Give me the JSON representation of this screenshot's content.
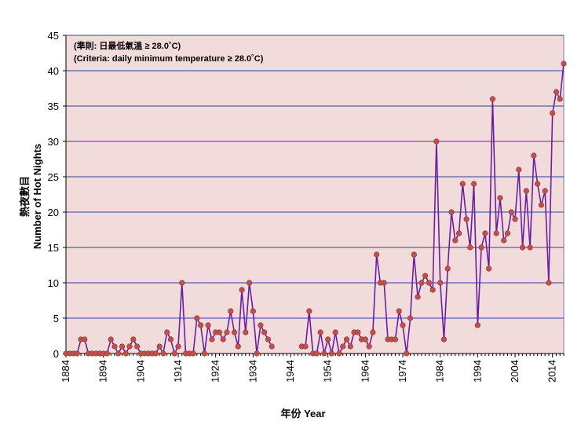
{
  "chart_data": {
    "type": "line",
    "annotation_lines": [
      "(準則: 日最低氣溫 ≥ 28.0˚C)",
      "(Criteria: daily minimum temperature ≥ 28.0˚C)"
    ],
    "ylabel_zh": "熱夜數目",
    "ylabel_en": "Number of Hot Nights",
    "xlabel": "年份 Year",
    "xlim": [
      1884,
      2017
    ],
    "ylim": [
      0,
      45
    ],
    "x_ticks": [
      1884,
      1894,
      1904,
      1914,
      1924,
      1934,
      1944,
      1954,
      1964,
      1974,
      1984,
      1994,
      2004,
      2014
    ],
    "y_ticks": [
      0,
      5,
      10,
      15,
      20,
      25,
      30,
      35,
      40,
      45
    ],
    "grid": "horizontal",
    "legend": "none",
    "colors": {
      "line": "#6a1fa0",
      "marker": "#c0504d",
      "plot_bg": "#f2dcdb",
      "grid": "#2f3fa0"
    },
    "series": [
      {
        "segments": [
          {
            "x": [
              1884,
              1885,
              1886,
              1887,
              1888,
              1889,
              1890,
              1891,
              1892,
              1893,
              1894,
              1895,
              1896,
              1897,
              1898,
              1899,
              1900,
              1901,
              1902,
              1903,
              1904,
              1905,
              1906,
              1907,
              1908,
              1909,
              1910,
              1911,
              1912,
              1913,
              1914,
              1915,
              1916,
              1917,
              1918,
              1919,
              1920,
              1921,
              1922,
              1923,
              1924,
              1925,
              1926,
              1927,
              1928,
              1929,
              1930,
              1931,
              1932,
              1933,
              1934,
              1935,
              1936,
              1937,
              1938,
              1939,
              1940
            ],
            "y": [
              0,
              0,
              0,
              0,
              2,
              2,
              0,
              0,
              0,
              0,
              0,
              0,
              2,
              1,
              0,
              1,
              0,
              1,
              2,
              1,
              0,
              0,
              0,
              0,
              0,
              1,
              0,
              3,
              2,
              0,
              1,
              10,
              0,
              0,
              0,
              5,
              4,
              0,
              4,
              2,
              3,
              3,
              2,
              3,
              6,
              3,
              1,
              9,
              3,
              10,
              6,
              0,
              4,
              3,
              2,
              1,
              null
            ]
          },
          {
            "x": [
              1947,
              1948,
              1949,
              1950,
              1951,
              1952,
              1953,
              1954,
              1955,
              1956,
              1957,
              1958,
              1959,
              1960,
              1961,
              1962,
              1963,
              1964,
              1965,
              1966,
              1967,
              1968,
              1969,
              1970,
              1971,
              1972,
              1973,
              1974,
              1975,
              1976,
              1977,
              1978,
              1979,
              1980,
              1981,
              1982,
              1983,
              1984,
              1985,
              1986,
              1987,
              1988,
              1989,
              1990,
              1991,
              1992,
              1993,
              1994,
              1995,
              1996,
              1997,
              1998,
              1999,
              2000,
              2001,
              2002,
              2003,
              2004,
              2005,
              2006,
              2007,
              2008,
              2009,
              2010,
              2011,
              2012,
              2013,
              2014,
              2015,
              2016,
              2017
            ],
            "y": [
              1,
              1,
              6,
              0,
              0,
              3,
              0,
              2,
              0,
              3,
              0,
              1,
              2,
              1,
              3,
              3,
              2,
              2,
              1,
              3,
              14,
              10,
              10,
              2,
              2,
              2,
              6,
              4,
              0,
              5,
              14,
              8,
              10,
              11,
              10,
              9,
              30,
              10,
              2,
              12,
              20,
              16,
              17,
              24,
              19,
              15,
              24,
              4,
              15,
              17,
              12,
              36,
              17,
              22,
              16,
              17,
              20,
              19,
              26,
              15,
              23,
              15,
              28,
              24,
              21,
              23,
              10,
              34,
              37,
              36,
              41
            ]
          }
        ]
      }
    ]
  }
}
